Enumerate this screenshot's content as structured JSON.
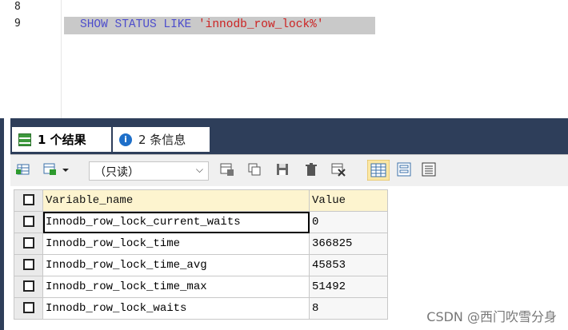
{
  "editor": {
    "line_numbers": [
      "8",
      "9"
    ],
    "query": {
      "keyword": "SHOW STATUS LIKE",
      "string": "'innodb_row_lock%'"
    }
  },
  "tabs": {
    "results_label": "1 个结果",
    "info_label": "2 条信息"
  },
  "toolbar": {
    "mode_value": "（只读）"
  },
  "grid": {
    "headers": [
      "Variable_name",
      "Value"
    ],
    "rows": [
      {
        "name": "Innodb_row_lock_current_waits",
        "value": "0"
      },
      {
        "name": "Innodb_row_lock_time",
        "value": "366825"
      },
      {
        "name": "Innodb_row_lock_time_avg",
        "value": "45853"
      },
      {
        "name": "Innodb_row_lock_time_max",
        "value": "51492"
      },
      {
        "name": "Innodb_row_lock_waits",
        "value": "8"
      }
    ]
  },
  "watermark": "CSDN @西门吹雪分身",
  "colors": {
    "frame": "#2e3e5a",
    "keyword": "#4d4dcc",
    "string": "#cc2222",
    "header_bg": "#fdf4cf"
  }
}
